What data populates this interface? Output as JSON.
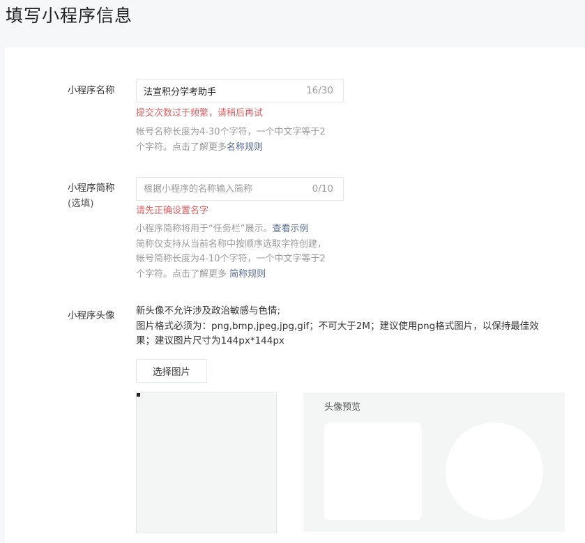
{
  "page": {
    "title": "填写小程序信息"
  },
  "name_field": {
    "label": "小程序名称",
    "value": "法宣积分学考助手",
    "counter": "16/30",
    "error": "提交次数过于频繁，请稍后再试",
    "tip_line1": "帐号名称长度为4-30个字符，一个中文字等于2",
    "tip_line2_prefix": "个字符。点击了解更多",
    "tip_link": "名称规则"
  },
  "short_name_field": {
    "label": "小程序简称",
    "label_sub": "(选填)",
    "placeholder": "根据小程序的名称输入简称",
    "counter": "0/10",
    "error": "请先正确设置名字",
    "tip_line1_prefix": "小程序简称将用于“任务栏”展示。",
    "tip_line1_link": "查看示例",
    "tip_line2": "简称仅支持从当前名称中按顺序选取字符创建，",
    "tip_line3": "帐号简称长度为4-10个字符，一个中文字等于2",
    "tip_line4_prefix": "个字符。点击了解更多 ",
    "tip_line4_link": "简称规则"
  },
  "avatar_field": {
    "label": "小程序头像",
    "desc_line1": "新头像不允许涉及政治敏感与色情;",
    "desc_line2": "图片格式必须为：png,bmp,jpeg,jpg,gif；不可大于2M；建议使用png格式图片，以保持最佳效",
    "desc_line3": "果；建议图片尺寸为144px*144px",
    "select_button": "选择图片",
    "preview_title": "头像预览"
  }
}
